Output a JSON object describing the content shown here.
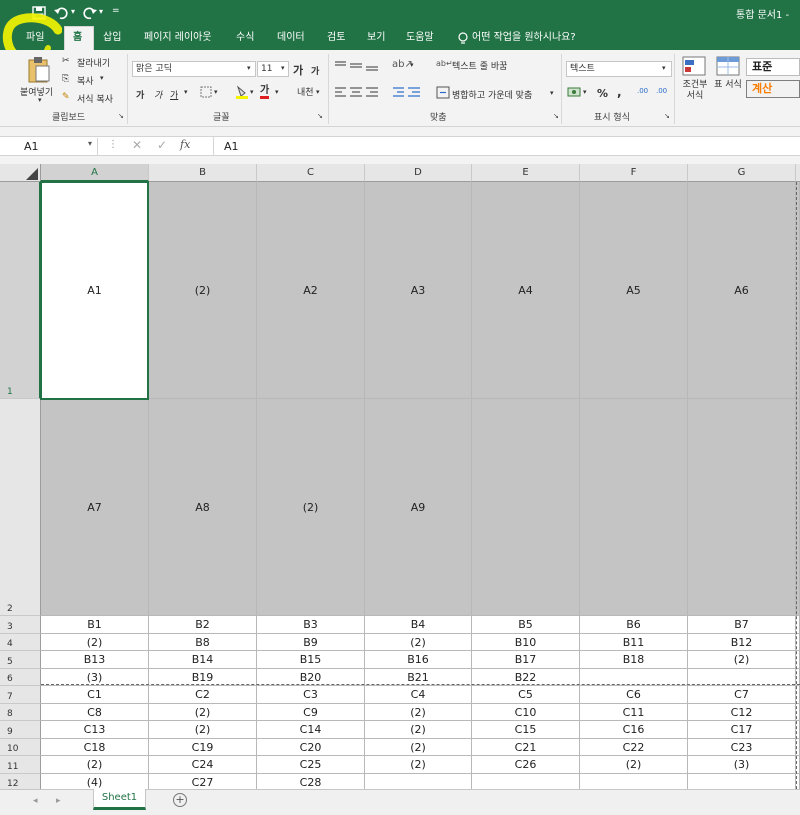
{
  "titlebar": {
    "title": "통합 문서1 -"
  },
  "tabs": [
    "파일",
    "홈",
    "삽입",
    "페이지 레이아웃",
    "수식",
    "데이터",
    "검토",
    "보기",
    "도움말"
  ],
  "tell_me": "어떤 작업을 원하시나요?",
  "clipboard": {
    "paste": "붙여넣기",
    "cut": "잘라내기",
    "copy": "복사",
    "format_painter": "서식 복사",
    "group": "클립보드"
  },
  "font": {
    "name": "맑은 고딕",
    "size": "11",
    "bold": "가",
    "italic": "가",
    "underline": "가",
    "grow": "가",
    "shrink": "가",
    "phonetic": "내천",
    "group": "글꼴"
  },
  "alignment": {
    "wrap": "텍스트 줄 바꿈",
    "merge": "병합하고 가운데 맞춤",
    "group": "맞춤"
  },
  "number": {
    "format": "텍스트",
    "percent": "%",
    "comma": ",",
    "dec_inc": ".00",
    "dec_dec": ".00",
    "group": "표시 형식"
  },
  "styles": {
    "conditional": "조건부 서식",
    "table": "표 서식",
    "normal": "표준",
    "calc": "계산"
  },
  "formula_bar": {
    "namebox": "A1",
    "fx": "fx",
    "value": "A1"
  },
  "columns": [
    "A",
    "B",
    "C",
    "D",
    "E",
    "F",
    "G"
  ],
  "rows": [
    "1",
    "2",
    "3",
    "4",
    "5",
    "6",
    "7",
    "8",
    "9",
    "10",
    "11",
    "12"
  ],
  "cells": {
    "r1": [
      "A1",
      "(2)",
      "A2",
      "A3",
      "A4",
      "A5",
      "A6"
    ],
    "r2": [
      "A7",
      "A8",
      "(2)",
      "A9",
      "",
      "",
      ""
    ],
    "r3": [
      "B1",
      "B2",
      "B3",
      "B4",
      "B5",
      "B6",
      "B7"
    ],
    "r4": [
      "(2)",
      "B8",
      "B9",
      "(2)",
      "B10",
      "B11",
      "B12"
    ],
    "r5": [
      "B13",
      "B14",
      "B15",
      "B16",
      "B17",
      "B18",
      "(2)"
    ],
    "r6": [
      "(3)",
      "B19",
      "B20",
      "B21",
      "B22",
      "",
      ""
    ],
    "r7": [
      "C1",
      "C2",
      "C3",
      "C4",
      "C5",
      "C6",
      "C7"
    ],
    "r8": [
      "C8",
      "(2)",
      "C9",
      "(2)",
      "C10",
      "C11",
      "C12"
    ],
    "r9": [
      "C13",
      "(2)",
      "C14",
      "(2)",
      "C15",
      "C16",
      "C17"
    ],
    "r10": [
      "C18",
      "C19",
      "C20",
      "(2)",
      "C21",
      "C22",
      "C23"
    ],
    "r11": [
      "(2)",
      "C24",
      "C25",
      "(2)",
      "C26",
      "(2)",
      "(3)"
    ],
    "r12": [
      "(4)",
      "C27",
      "C28",
      "",
      "",
      "",
      ""
    ]
  },
  "sheet_tab": "Sheet1",
  "add_sheet": "+",
  "colors": {
    "excel_green": "#217346",
    "cell_gray": "#c4c4c4",
    "highlight": "#f5f500"
  }
}
